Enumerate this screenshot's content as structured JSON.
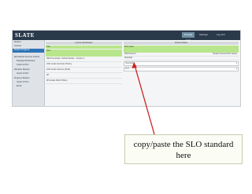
{
  "app": {
    "logo": "SLATE"
  },
  "header": {
    "user_button": "Proudly Host",
    "settings_label": "Settings",
    "logout_label": "Log Out"
  },
  "sidebar": {
    "items": [
      {
        "label": "Student"
      },
      {
        "label": "Courses"
      },
      {
        "label": "Student Progress",
        "highlighted": true
      },
      {
        "label": "Educational Success Criteria"
      },
      {
        "label": "Package Worksheets"
      },
      {
        "label": "Import & Print"
      },
      {
        "label": "Narrative Reports"
      },
      {
        "label": "Import & Print"
      },
      {
        "label": "Progress Reports"
      },
      {
        "label": "Import & Print"
      },
      {
        "label": "Email"
      }
    ]
  },
  "left_panel": {
    "header": "Course Worksheets",
    "selected_rows": [
      "Title",
      "Term"
    ],
    "rows": [
      "SWI Humanities: Global Studies - Section 2",
      "10th Grade American History",
      "10th Grade Science (2014)",
      "AP",
      "9th Grade World History"
    ]
  },
  "right_panel": {
    "header": "Course Report",
    "title_value": "SLO name",
    "term_label": "SWI Period 2",
    "term_right": "Student list and SLO values",
    "standard_label": "Standard",
    "standard_value": "Standard A",
    "select_value": "SLO"
  },
  "callout": {
    "text": "copy/paste the SLO standard here"
  },
  "colors": {
    "arrow": "#cc2222",
    "topbar": "#2b3a4a",
    "highlight_green": "#b8e68c"
  }
}
